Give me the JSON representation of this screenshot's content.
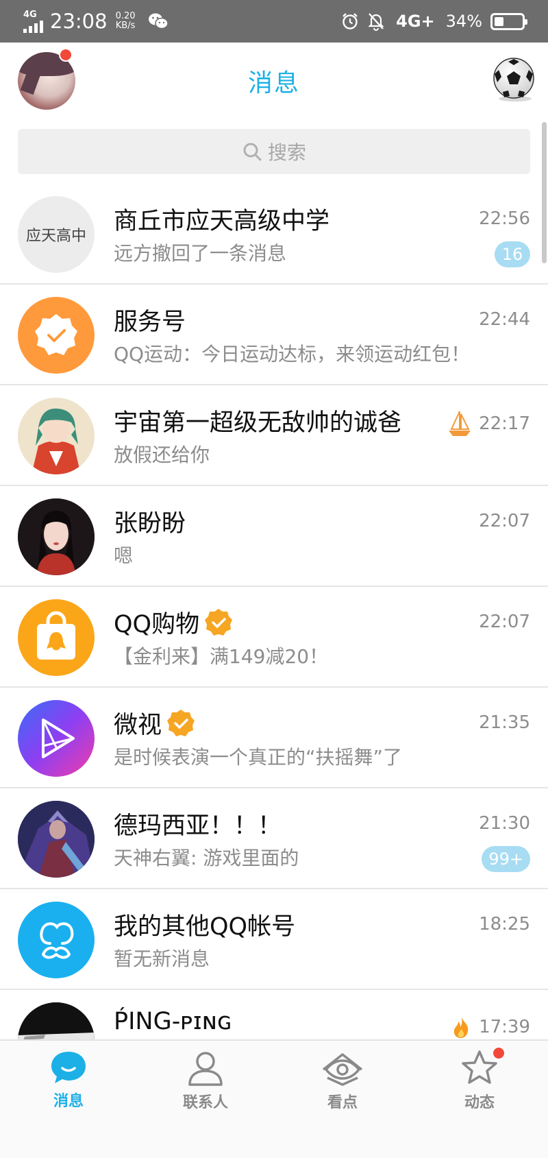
{
  "status_bar": {
    "network_left": "4G",
    "time": "23:08",
    "speed_value": "0.20",
    "speed_unit": "KB/s",
    "network_right": "4G+",
    "battery_percent": "34%",
    "battery_level": 0.34
  },
  "header": {
    "title": "消息"
  },
  "search": {
    "placeholder": "搜索"
  },
  "conversations": [
    {
      "name": "商丘市应天高级中学",
      "avatar_text": "应天高中",
      "preview": "远方撤回了一条消息",
      "time": "22:56",
      "unread": "16"
    },
    {
      "name": "服务号",
      "preview": "QQ运动：今日运动达标，来领运动红包！",
      "time": "22:44"
    },
    {
      "name": "宇宙第一超级无敌帅的诚爸",
      "preview": "放假还给你",
      "time": "22:17"
    },
    {
      "name": "张盼盼",
      "preview": "嗯",
      "time": "22:07"
    },
    {
      "name": "QQ购物",
      "preview": "【金利来】满149减20！",
      "time": "22:07"
    },
    {
      "name": "微视",
      "preview": "是时候表演一个真正的“扶摇舞”了",
      "time": "21:35"
    },
    {
      "name": "德玛西亚！！！",
      "preview": "天神右翼: 游戏里面的",
      "time": "21:30",
      "unread": "99+"
    },
    {
      "name": "我的其他QQ帐号",
      "preview": "暂无新消息",
      "time": "18:25"
    },
    {
      "name": "ṔING-ᴘɪɴɢ",
      "preview": "",
      "time": "17:39"
    }
  ],
  "tabs": [
    {
      "label": "消息"
    },
    {
      "label": "联系人"
    },
    {
      "label": "看点"
    },
    {
      "label": "动态"
    }
  ],
  "colors": {
    "accent": "#1cb0e6",
    "unread_badge": "#a7dcf3",
    "notification_dot": "#f2483a",
    "status_bar": "#6d6d6d"
  }
}
